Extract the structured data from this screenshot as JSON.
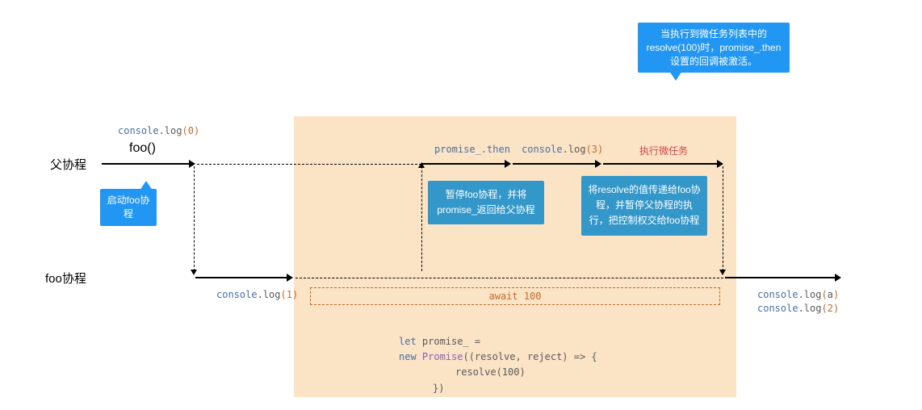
{
  "labels": {
    "parent_coroutine": "父协程",
    "foo_coroutine": "foo协程",
    "foo_call": "foo()"
  },
  "annotations": {
    "promise_then": "promise_.then",
    "exec_microtask": "执行微任务",
    "log0": "console.log(0)",
    "log1": "console.log(1)",
    "log3": "console.log(3)",
    "loga": "console.log(a)",
    "log2": "console.log(2)"
  },
  "callouts": {
    "start_foo": "启动foo协程",
    "microtask_resolve": "当执行到微任务列表中的resolve(100)时，promise_.then设置的回调被激活。"
  },
  "blueboxes": {
    "pause_foo": "暂停foo协程，并将promise_返回给父协程",
    "pass_resolve": "将resolve的值传递给foo协程，并暂停父协程的执行，把控制权交给foo协程"
  },
  "await_box": "await 100",
  "code_block": {
    "l1a": "let",
    "l1b": " promise_ =",
    "l2a": "new ",
    "l2b": "Promise",
    "l2c": "((resolve, reject) => {",
    "l3": "resolve(100)",
    "l4": "})"
  }
}
